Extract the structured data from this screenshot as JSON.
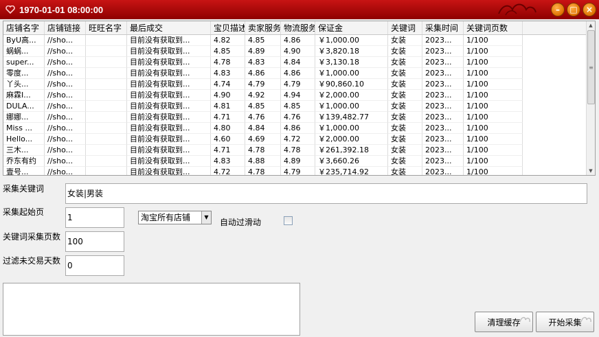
{
  "window": {
    "title": "1970-01-01 08:00:00"
  },
  "grid": {
    "columns": [
      "店铺名字",
      "店铺链接",
      "旺旺名字",
      "最后成交",
      "宝贝描述",
      "卖家服务",
      "物流服务",
      "保证金",
      "关键词",
      "采集时间",
      "关键词页数"
    ],
    "rows": [
      [
        "ByU高...",
        "//sho...",
        "",
        "目前没有获取到...",
        "4.82",
        "4.85",
        "4.86",
        "￥1,000.00",
        "女装",
        "2023...",
        "1/100"
      ],
      [
        "蜗蜗...",
        "//sho...",
        "",
        "目前没有获取到...",
        "4.85",
        "4.89",
        "4.90",
        "￥3,820.18",
        "女装",
        "2023...",
        "1/100"
      ],
      [
        "super...",
        "//sho...",
        "",
        "目前没有获取到...",
        "4.78",
        "4.83",
        "4.84",
        "￥3,130.18",
        "女装",
        "2023...",
        "1/100"
      ],
      [
        "零度...",
        "//sho...",
        "",
        "目前没有获取到...",
        "4.83",
        "4.86",
        "4.86",
        "￥1,000.00",
        "女装",
        "2023...",
        "1/100"
      ],
      [
        "丫头...",
        "//sho...",
        "",
        "目前没有获取到...",
        "4.74",
        "4.79",
        "4.79",
        "￥90,860.10",
        "女装",
        "2023...",
        "1/100"
      ],
      [
        "麻霖I...",
        "//sho...",
        "",
        "目前没有获取到...",
        "4.90",
        "4.92",
        "4.94",
        "￥2,000.00",
        "女装",
        "2023...",
        "1/100"
      ],
      [
        "DULA...",
        "//sho...",
        "",
        "目前没有获取到...",
        "4.81",
        "4.85",
        "4.85",
        "￥1,000.00",
        "女装",
        "2023...",
        "1/100"
      ],
      [
        "娜娜...",
        "//sho...",
        "",
        "目前没有获取到...",
        "4.71",
        "4.76",
        "4.76",
        "￥139,482.77",
        "女装",
        "2023...",
        "1/100"
      ],
      [
        "Miss ...",
        "//sho...",
        "",
        "目前没有获取到...",
        "4.80",
        "4.84",
        "4.86",
        "￥1,000.00",
        "女装",
        "2023...",
        "1/100"
      ],
      [
        "Hello...",
        "//sho...",
        "",
        "目前没有获取到...",
        "4.60",
        "4.69",
        "4.72",
        "￥2,000.00",
        "女装",
        "2023...",
        "1/100"
      ],
      [
        "三木...",
        "//sho...",
        "",
        "目前没有获取到...",
        "4.71",
        "4.78",
        "4.78",
        "￥261,392.18",
        "女装",
        "2023...",
        "1/100"
      ],
      [
        "乔东有约",
        "//sho...",
        "",
        "目前没有获取到...",
        "4.83",
        "4.88",
        "4.89",
        "￥3,660.26",
        "女装",
        "2023...",
        "1/100"
      ],
      [
        "壹号...",
        "//sho...",
        "",
        "目前没有获取到...",
        "4.72",
        "4.78",
        "4.79",
        "￥235,714.92",
        "女装",
        "2023...",
        "1/100"
      ]
    ]
  },
  "form": {
    "keyword_label": "采集关键词",
    "keyword_value": "女装|男装",
    "start_page_label": "采集起始页",
    "start_page_value": "1",
    "pages_label": "关键词采集页数",
    "pages_value": "100",
    "filter_days_label": "过滤未交易天数",
    "filter_days_value": "0",
    "shop_type_selected": "淘宝所有店铺",
    "auto_slide_label": "自动过滑动",
    "auto_slide_checked": false
  },
  "buttons": {
    "clear_cache": "清理缓存",
    "start": "开始采集"
  },
  "colors": {
    "title_bar": "#b80808",
    "window_button": "#f08a10"
  }
}
